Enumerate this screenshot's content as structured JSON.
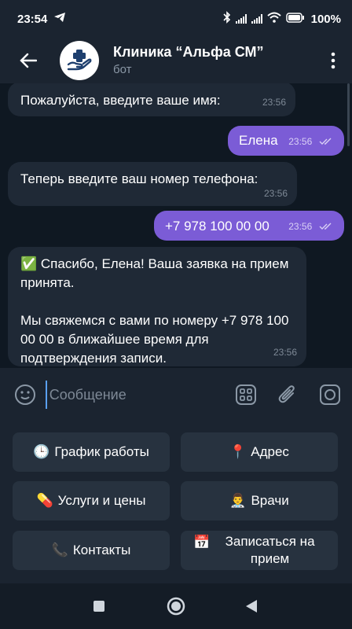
{
  "status_bar": {
    "time": "23:54",
    "battery": "100%"
  },
  "header": {
    "title": "Клиника “Альфа СМ”",
    "subtitle": "бот"
  },
  "messages": [
    {
      "dir": "in",
      "text": "Пожалуйста, введите ваше имя:",
      "time": "23:56"
    },
    {
      "dir": "out",
      "text": "Елена",
      "time": "23:56"
    },
    {
      "dir": "in",
      "text": "Теперь введите ваш номер телефона:",
      "time": "23:56"
    },
    {
      "dir": "out",
      "text": "+7 978 100 00 00",
      "time": "23:56"
    },
    {
      "dir": "in",
      "line1": "✅ Спасибо, Елена! Ваша заявка на прием принята.",
      "line2": "Мы свяжемся с вами по номеру +7 978 100 00 00 в ближайшее время для подтверждения записи.",
      "time": "23:56"
    }
  ],
  "input": {
    "placeholder": "Сообщение"
  },
  "keyboard": [
    {
      "emoji": "🕒",
      "label": "График работы"
    },
    {
      "emoji": "📍",
      "label": "Адрес"
    },
    {
      "emoji": "💊",
      "label": "Услуги и цены"
    },
    {
      "emoji": "👨‍⚕️",
      "label": "Врачи"
    },
    {
      "emoji": "📞",
      "label": "Контакты"
    },
    {
      "emoji": "📅",
      "label": "Записаться на прием"
    }
  ],
  "colors": {
    "accent": "#7b5cd6",
    "background": "#0e1621",
    "bubble_in": "#1f2936"
  }
}
